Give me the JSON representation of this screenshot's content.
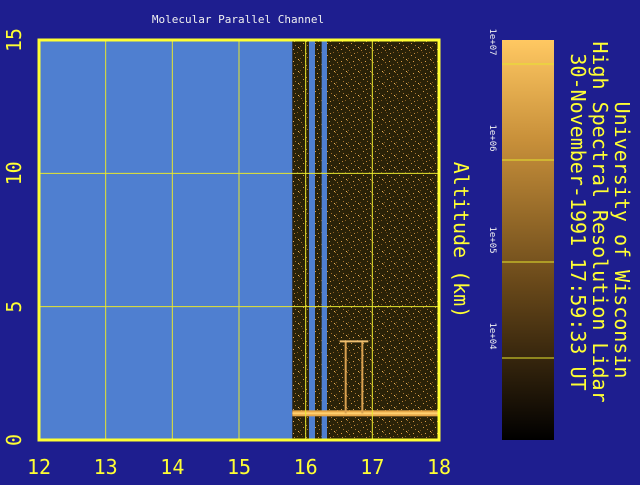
{
  "colors": {
    "background": "#1e1e8f",
    "axis": "#ffff33",
    "grid": "#e6e62e",
    "no_data": "#4f7fd0",
    "text": "#ffff33",
    "title_text": "#f0f0f0"
  },
  "chart_data": {
    "type": "heatmap",
    "title": "Molecular Parallel Channel",
    "xlabel": "",
    "ylabel": "Altitude (km)",
    "xlim": [
      12,
      18
    ],
    "ylim": [
      0,
      15
    ],
    "x_ticks": [
      12,
      13,
      14,
      15,
      16,
      17,
      18
    ],
    "y_ticks": [
      0,
      5,
      10,
      15
    ],
    "grid": true,
    "data_coverage": {
      "no_data_before_x": 15.8,
      "no_data_gaps_x": [
        [
          16.05,
          16.14
        ],
        [
          16.24,
          16.32
        ]
      ],
      "surface_return_altitude_km": 1.0,
      "plume_x": [
        16.6,
        16.85
      ],
      "plume_top_altitude_km": 3.7
    },
    "colorbar": {
      "scale": "log",
      "tick_labels": [
        "1e+07",
        "1e+06",
        "1e+05",
        "1e+04"
      ],
      "colors_low_to_high": [
        "#000000",
        "#6b4a1a",
        "#c8903a",
        "#ffc862"
      ]
    }
  },
  "header": {
    "line1": "University of Wisconsin",
    "line2": "High Spectral Resolution Lidar",
    "line3": "30-November-1991 17:59:33 UT"
  }
}
